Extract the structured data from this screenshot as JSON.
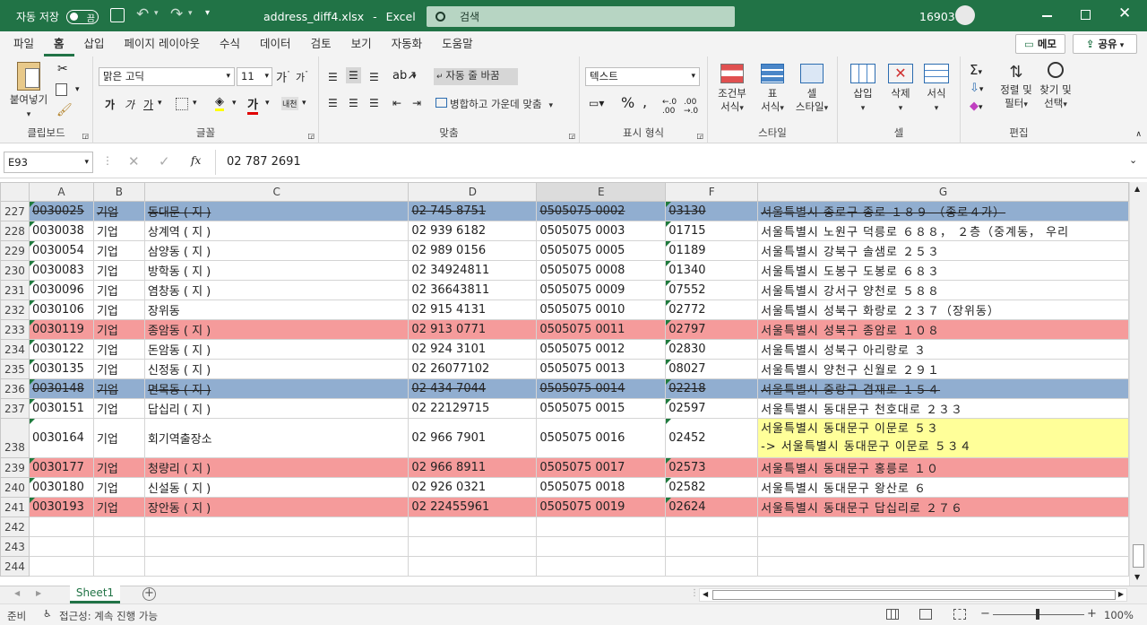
{
  "titlebar": {
    "autosave_label": "자동 저장",
    "autosave_state": "끔",
    "filename": "address_diff4.xlsx",
    "app": "Excel",
    "separator": "-",
    "search_placeholder": "검색",
    "user": "16903"
  },
  "menu": {
    "items": [
      "파일",
      "홈",
      "삽입",
      "페이지 레이아웃",
      "수식",
      "데이터",
      "검토",
      "보기",
      "자동화",
      "도움말"
    ],
    "memo": "메모",
    "share": "공유"
  },
  "ribbon": {
    "paste": "붙여넣기",
    "clipboard": "클립보드",
    "font_name": "맑은 고딕",
    "font_size": "11",
    "font_group": "글꼴",
    "wrap_text": "자동 줄 바꿈",
    "merge_center": "병합하고 가운데 맞춤",
    "align_group": "맞춤",
    "number_format": "텍스트",
    "number_group": "표시 형식",
    "cond_format": "조건부\n서식",
    "table_format": "표\n서식",
    "cell_style": "셀\n스타일",
    "style_group": "스타일",
    "insert": "삽입",
    "delete": "삭제",
    "format": "서식",
    "cells_group": "셀",
    "sort_filter": "정렬 및\n필터",
    "find_select": "찾기 및\n선택",
    "edit_group": "편집"
  },
  "formula_bar": {
    "name_box": "E93",
    "fx": "fx",
    "value": "02 787 2691"
  },
  "columns": [
    "A",
    "B",
    "C",
    "D",
    "E",
    "F",
    "G"
  ],
  "rows": [
    {
      "n": "227",
      "style": "blue",
      "c": [
        "0030025",
        "기업",
        "동대문 ( 지 )",
        "02 745 8751",
        "0505075 0002",
        "03130",
        "서울특별시  종로구  종로  １８９  （종로４가）"
      ]
    },
    {
      "n": "228",
      "style": "",
      "c": [
        "0030038",
        "기업",
        "상계역 ( 지 )",
        "02 939 6182",
        "0505075 0003",
        "01715",
        "서울특별시  노원구  덕릉로  ６８８，  ２층（중계동，  우리"
      ]
    },
    {
      "n": "229",
      "style": "",
      "c": [
        "0030054",
        "기업",
        "삼양동 ( 지 )",
        "02 989 0156",
        "0505075 0005",
        "01189",
        "서울특별시  강북구  솔샘로  ２５３"
      ]
    },
    {
      "n": "230",
      "style": "",
      "c": [
        "0030083",
        "기업",
        "방학동 ( 지 )",
        "02 34924811",
        "0505075 0008",
        "01340",
        "서울특별시  도봉구  도봉로  ６８３"
      ]
    },
    {
      "n": "231",
      "style": "",
      "c": [
        "0030096",
        "기업",
        "염창동 ( 지 )",
        "02 36643811",
        "0505075 0009",
        "07552",
        "서울특별시  강서구  양천로  ５８８"
      ]
    },
    {
      "n": "232",
      "style": "",
      "c": [
        "0030106",
        "기업",
        "장위동",
        "02 915 4131",
        "0505075 0010",
        "02772",
        "서울특별시  성북구  화랑로  ２３７（장위동）"
      ]
    },
    {
      "n": "233",
      "style": "red",
      "c": [
        "0030119",
        "기업",
        "종암동 ( 지 )",
        "02 913 0771",
        "0505075 0011",
        "02797",
        "서울특별시  성북구  종암로  １０８"
      ]
    },
    {
      "n": "234",
      "style": "",
      "c": [
        "0030122",
        "기업",
        "돈암동 ( 지 )",
        "02 924 3101",
        "0505075 0012",
        "02830",
        "서울특별시  성북구  아리랑로  ３"
      ]
    },
    {
      "n": "235",
      "style": "",
      "c": [
        "0030135",
        "기업",
        "신정동 ( 지 )",
        "02 26077102",
        "0505075 0013",
        "08027",
        "서울특별시  양천구  신월로  ２９１"
      ]
    },
    {
      "n": "236",
      "style": "blue",
      "c": [
        "0030148",
        "기업",
        "면목동 ( 지 )",
        "02 434 7044",
        "0505075 0014",
        "02218",
        "서울특별시  중랑구  겸재로  １５４"
      ]
    },
    {
      "n": "237",
      "style": "",
      "c": [
        "0030151",
        "기업",
        "답십리 ( 지 )",
        "02 22129715",
        "0505075 0015",
        "02597",
        "서울특별시  동대문구  천호대로  ２３３"
      ]
    },
    {
      "n": "238",
      "style": "yellow",
      "c": [
        "0030164",
        "기업",
        "회기역출장소",
        "02 966 7901",
        "0505075 0016",
        "02452",
        "서울특별시  동대문구  이문로  ５３"
      ],
      "g2": "-> 서울특별시  동대문구  이문로  ５３４"
    },
    {
      "n": "239",
      "style": "red",
      "c": [
        "0030177",
        "기업",
        "청량리 ( 지 )",
        "02 966 8911",
        "0505075 0017",
        "02573",
        "서울특별시  동대문구  홍릉로  １０"
      ]
    },
    {
      "n": "240",
      "style": "",
      "c": [
        "0030180",
        "기업",
        "신설동 ( 지 )",
        "02 926 0321",
        "0505075 0018",
        "02582",
        "서울특별시  동대문구  왕산로  ６"
      ]
    },
    {
      "n": "241",
      "style": "red",
      "c": [
        "0030193",
        "기업",
        "장안동 ( 지 )",
        "02 22455961",
        "0505075 0019",
        "02624",
        "서울특별시  동대문구  답십리로  ２７６"
      ]
    },
    {
      "n": "242",
      "style": "",
      "c": [
        "",
        "",
        "",
        "",
        "",
        "",
        ""
      ]
    },
    {
      "n": "243",
      "style": "",
      "c": [
        "",
        "",
        "",
        "",
        "",
        "",
        ""
      ]
    },
    {
      "n": "244",
      "style": "",
      "c": [
        "",
        "",
        "",
        "",
        "",
        "",
        ""
      ]
    }
  ],
  "sheet": {
    "tab": "Sheet1"
  },
  "status": {
    "ready": "준비",
    "accessibility": "접근성: 계속 진행 가능",
    "zoom": "100%"
  },
  "colors": {
    "accent": "#217346",
    "deleted_row": "#91aed0",
    "changed_row": "#f59b9b",
    "modified_cell": "#ffff99"
  }
}
